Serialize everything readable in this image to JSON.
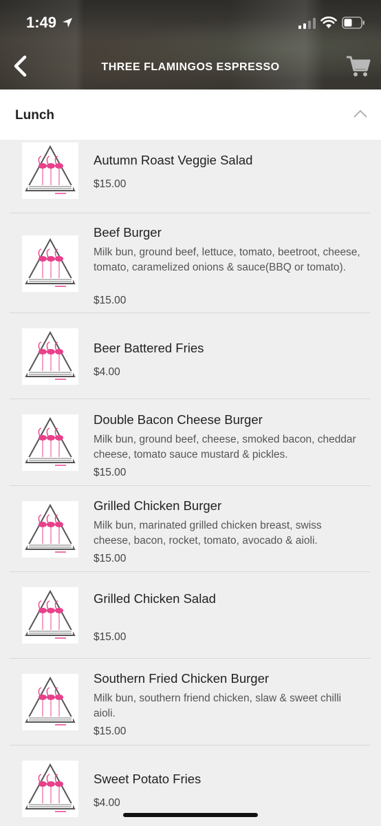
{
  "status_bar": {
    "time": "1:49"
  },
  "header": {
    "title": "THREE FLAMINGOS ESPRESSO"
  },
  "section": {
    "title": "Lunch"
  },
  "items": [
    {
      "name": "Autumn Roast Veggie Salad",
      "description": "",
      "price": "$15.00"
    },
    {
      "name": "Beef Burger",
      "description": "Milk bun, ground beef, lettuce, tomato, beetroot, cheese, tomato, caramelized onions & sauce(BBQ or tomato).",
      "price": "$15.00"
    },
    {
      "name": "Beer Battered Fries",
      "description": "",
      "price": "$4.00"
    },
    {
      "name": "Double Bacon Cheese Burger",
      "description": "Milk bun, ground beef, cheese, smoked bacon, cheddar cheese, tomato sauce mustard & pickles.",
      "price": "$15.00"
    },
    {
      "name": "Grilled Chicken Burger",
      "description": "Milk bun, marinated grilled chicken breast, swiss cheese, bacon, rocket, tomato, avocado & aioli.",
      "price": "$15.00"
    },
    {
      "name": "Grilled Chicken Salad",
      "description": "",
      "price": "$15.00"
    },
    {
      "name": "Southern Fried Chicken Burger",
      "description": "Milk bun, southern friend chicken, slaw & sweet chilli aioli.",
      "price": "$15.00"
    },
    {
      "name": "Sweet Potato Fries",
      "description": "",
      "price": "$4.00"
    }
  ],
  "icons": {
    "back": "chevron-left-icon",
    "cart": "cart-icon",
    "collapse": "chevron-up-icon",
    "thumbnail": "three-flamingos-logo"
  },
  "colors": {
    "flamingo_pink": "#e8418c",
    "logo_gray": "#555555"
  }
}
